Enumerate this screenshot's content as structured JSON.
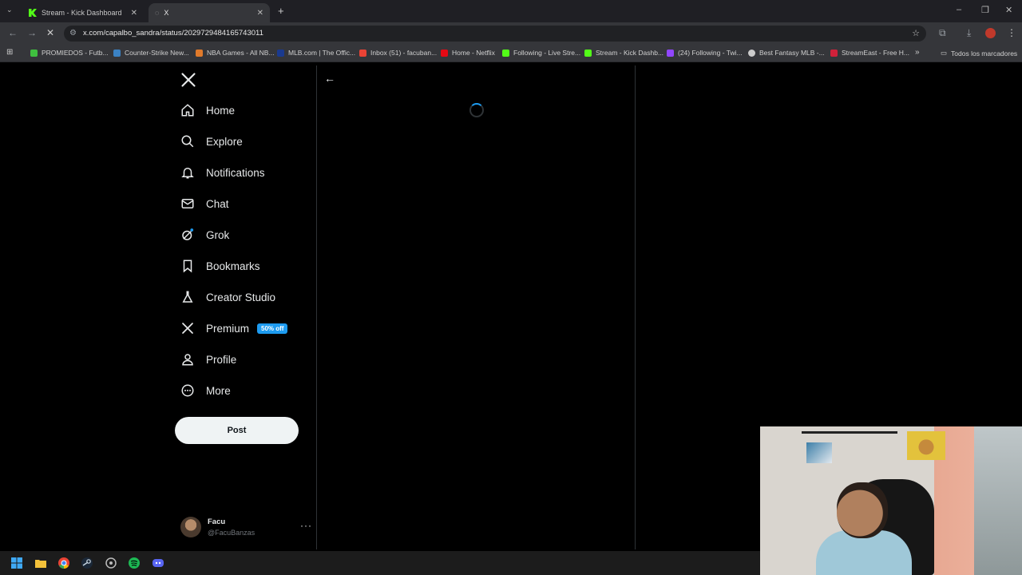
{
  "browser": {
    "tabs": [
      {
        "title": "Stream - Kick Dashboard",
        "active": false
      },
      {
        "title": "X",
        "active": true
      }
    ],
    "url": "x.com/capalbo_sandra/status/2029729484165743011",
    "bookmarks": [
      {
        "label": "PROMIEDOS - Futb...",
        "color": "#3fbf3f"
      },
      {
        "label": "Counter-Strike New...",
        "color": "#3b82c4"
      },
      {
        "label": "NBA Games - All NB...",
        "color": "#e07a2b"
      },
      {
        "label": "MLB.com | The Offic...",
        "color": "#1a3a8f"
      },
      {
        "label": "Inbox (51) - facuban...",
        "color": "#ea4335"
      },
      {
        "label": "Home - Netflix",
        "color": "#e50914"
      },
      {
        "label": "Following - Live Stre...",
        "color": "#53fc18"
      },
      {
        "label": "Stream - Kick Dashb...",
        "color": "#53fc18"
      },
      {
        "label": "(24) Following - Twi...",
        "color": "#9146ff"
      },
      {
        "label": "Best Fantasy MLB -...",
        "color": "#cccccc"
      },
      {
        "label": "StreamEast - Free H...",
        "color": "#d0213a"
      }
    ],
    "all_bookmarks": "Todos los marcadores"
  },
  "sidebar": {
    "items": [
      {
        "label": "Home",
        "icon": "home-icon"
      },
      {
        "label": "Explore",
        "icon": "search-icon"
      },
      {
        "label": "Notifications",
        "icon": "bell-icon"
      },
      {
        "label": "Chat",
        "icon": "mail-icon"
      },
      {
        "label": "Grok",
        "icon": "grok-icon"
      },
      {
        "label": "Bookmarks",
        "icon": "bookmark-icon"
      },
      {
        "label": "Creator Studio",
        "icon": "flask-icon"
      },
      {
        "label": "Premium",
        "icon": "x-icon",
        "badge": "50% off"
      },
      {
        "label": "Profile",
        "icon": "person-icon"
      },
      {
        "label": "More",
        "icon": "more-circle-icon"
      }
    ],
    "post_label": "Post",
    "account": {
      "name": "Facu",
      "handle": "@FacuBanzas"
    }
  },
  "colors": {
    "accent": "#1d9bf0",
    "background": "#000000",
    "text": "#e7e9ea"
  }
}
